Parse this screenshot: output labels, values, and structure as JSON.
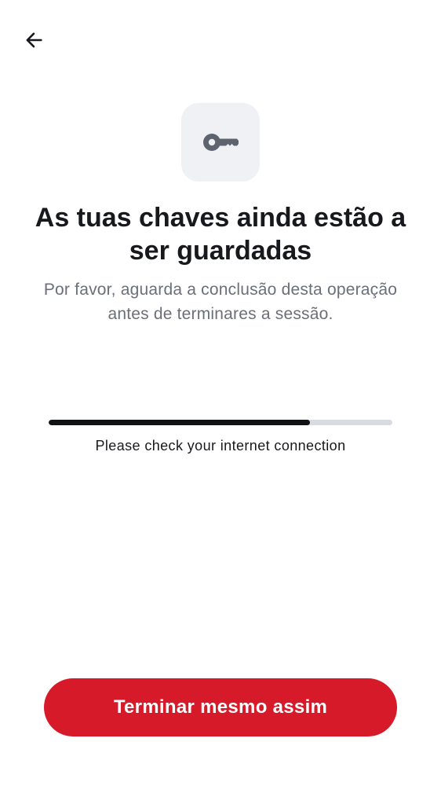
{
  "header": {
    "back_icon": "arrow-left-icon"
  },
  "hero": {
    "icon": "key-icon",
    "title": "As tuas chaves ainda estão a ser guardadas",
    "subtitle": "Por favor, aguarda a conclusão desta operação antes de terminares a sessão."
  },
  "progress": {
    "fraction": 0.76,
    "status": "Please check your internet connection"
  },
  "actions": {
    "finish_label": "Terminar mesmo assim"
  },
  "colors": {
    "accent": "#d71a29",
    "progress_fill": "#111214",
    "progress_track": "#d8dbe2",
    "icon_tile": "#f0f1f4",
    "icon": "#5d6470"
  }
}
